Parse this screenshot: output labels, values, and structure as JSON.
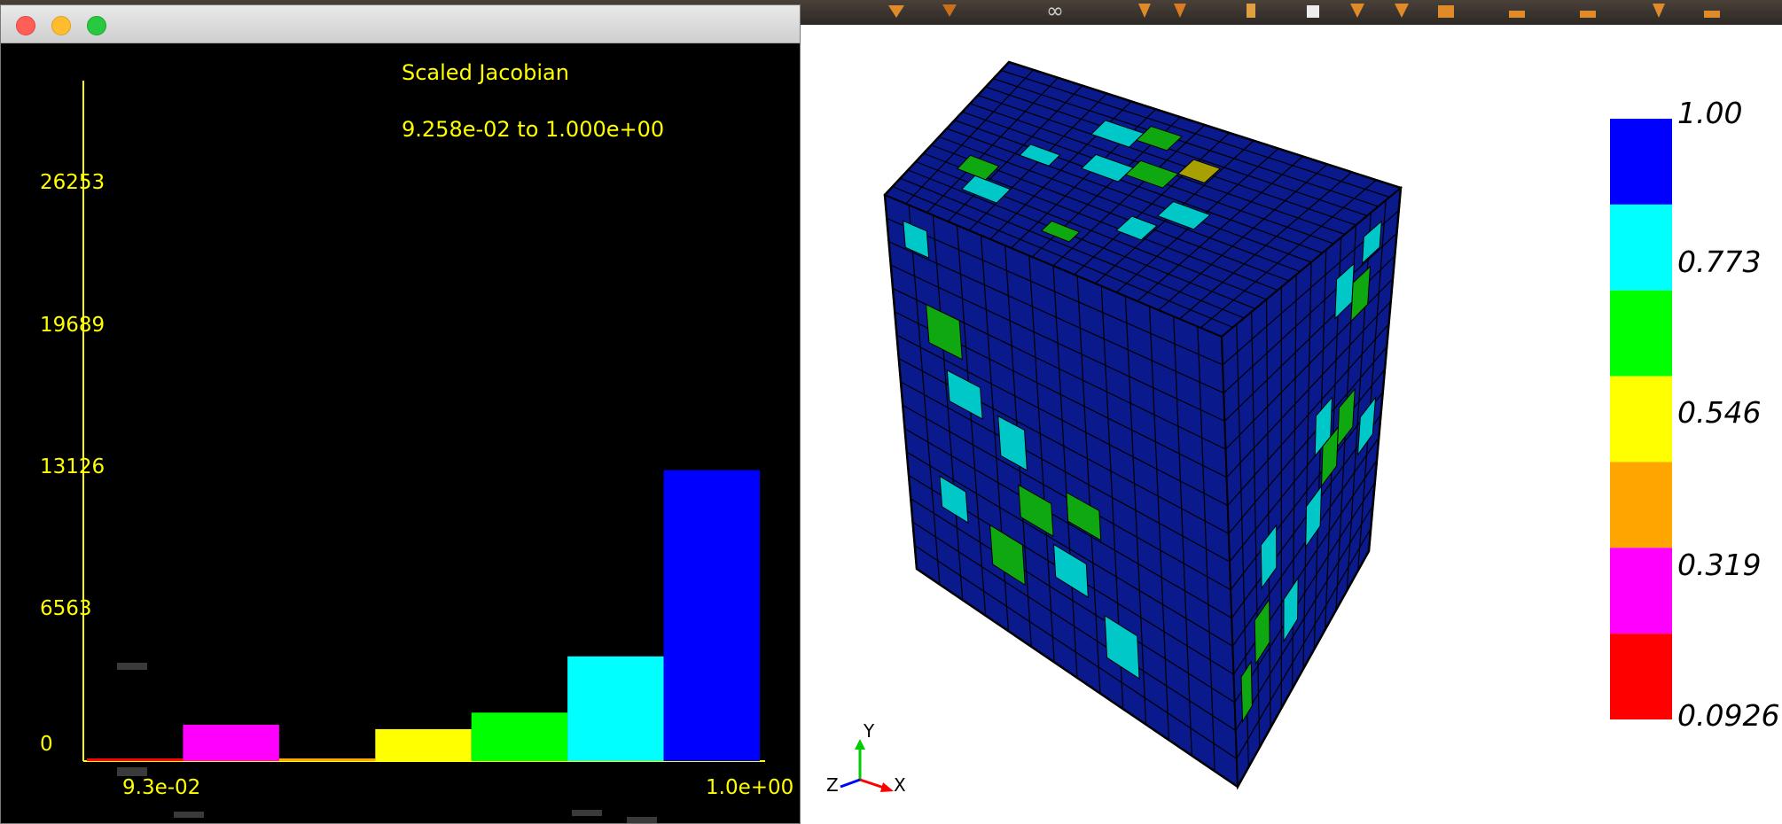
{
  "histogram": {
    "title": "Scaled Jacobian",
    "range_text": "9.258e-02 to 1.000e+00",
    "y_ticks": [
      "26253",
      "19689",
      "13126",
      "6563",
      "0"
    ],
    "x_min_label": "9.3e-02",
    "x_max_label": "1.0e+00"
  },
  "chart_data": {
    "type": "bar",
    "title": "Scaled Jacobian",
    "subtitle": "9.258e-02 to 1.000e+00",
    "ylim": [
      0,
      26253
    ],
    "y_ticks": [
      0,
      6563,
      13126,
      19689,
      26253
    ],
    "x_labels": [
      "9.3e-02",
      "1.0e+00"
    ],
    "bins": [
      {
        "value": 60,
        "color": "#ff0000"
      },
      {
        "value": 1650,
        "color": "#ff00ff"
      },
      {
        "value": 60,
        "color": "#ffa500"
      },
      {
        "value": 1450,
        "color": "#ffff00"
      },
      {
        "value": 2200,
        "color": "#00ff00"
      },
      {
        "value": 4750,
        "color": "#00ffff"
      },
      {
        "value": 13200,
        "color": "#0000ff"
      }
    ]
  },
  "legend": {
    "labels": [
      "1.00",
      "0.773",
      "0.546",
      "0.319",
      "0.0926"
    ],
    "colors": [
      "#0000ff",
      "#00ffff",
      "#00ff00",
      "#ffff00",
      "#ffa500",
      "#ff00ff",
      "#ff0000"
    ]
  },
  "axes": {
    "x": "X",
    "y": "Y",
    "z": "Z"
  },
  "mesh": {
    "base_color": "#0a1a8c",
    "line_color": "#000000"
  }
}
